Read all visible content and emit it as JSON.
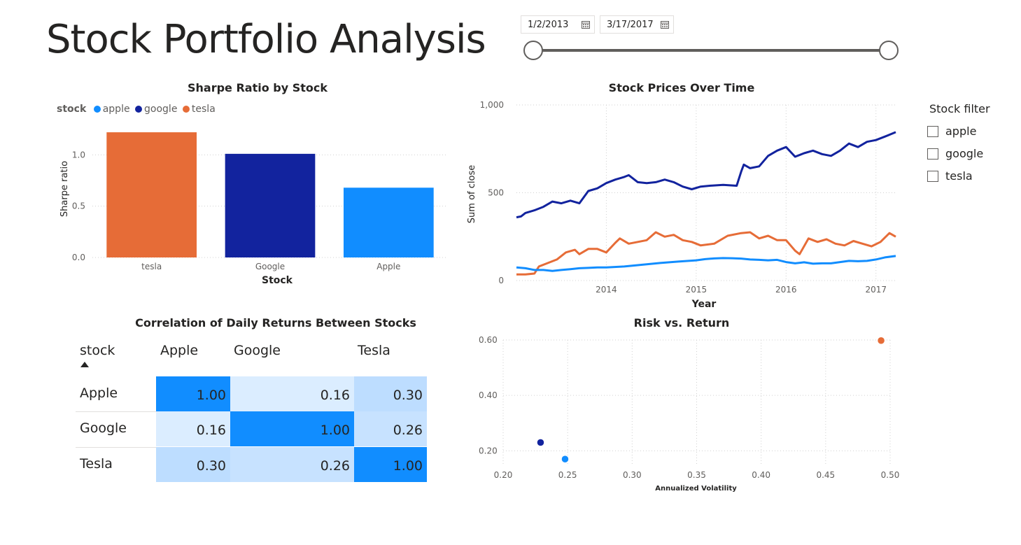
{
  "page": {
    "title": "Stock Portfolio Analysis"
  },
  "date_range": {
    "start": "1/2/2013",
    "end": "3/17/2017"
  },
  "stock_filter": {
    "title": "Stock filter",
    "options": [
      "apple",
      "google",
      "tesla"
    ]
  },
  "colors": {
    "apple": "#118DFF",
    "google": "#12239E",
    "tesla": "#E66C37"
  },
  "chart_data": [
    {
      "type": "bar",
      "title": "Sharpe Ratio by Stock",
      "legend_title": "stock",
      "legend": [
        "apple",
        "google",
        "tesla"
      ],
      "categories": [
        "tesla",
        "Google",
        "Apple"
      ],
      "values": [
        1.22,
        1.01,
        0.68
      ],
      "bar_colors": [
        "#E66C37",
        "#12239E",
        "#118DFF"
      ],
      "xlabel": "Stock",
      "ylabel": "Sharpe ratio",
      "ylim": [
        0,
        1.35
      ],
      "yticks": [
        0.0,
        0.5,
        1.0
      ],
      "ytick_labels": [
        "0.0",
        "0.5",
        "1.0"
      ],
      "grid": true
    },
    {
      "type": "line",
      "title": "Stock Prices Over Time",
      "xlabel": "Year",
      "ylabel": "Sum of close",
      "xlim": [
        2013.0,
        2017.22
      ],
      "xticks": [
        2014,
        2015,
        2016,
        2017
      ],
      "ylim": [
        0,
        1000
      ],
      "yticks": [
        0,
        500,
        1000
      ],
      "ytick_labels": [
        "0",
        "500",
        "1,000"
      ],
      "grid": true,
      "series": [
        {
          "color": "#12239E",
          "x": [
            2013.0,
            2013.05,
            2013.1,
            2013.2,
            2013.3,
            2013.4,
            2013.5,
            2013.6,
            2013.7,
            2013.8,
            2013.9,
            2014.0,
            2014.1,
            2014.2,
            2014.25,
            2014.35,
            2014.45,
            2014.55,
            2014.65,
            2014.75,
            2014.85,
            2014.95,
            2015.05,
            2015.15,
            2015.3,
            2015.45,
            2015.5,
            2015.53,
            2015.6,
            2015.7,
            2015.8,
            2015.9,
            2016.0,
            2016.1,
            2016.2,
            2016.3,
            2016.4,
            2016.5,
            2016.6,
            2016.7,
            2016.8,
            2016.9,
            2017.0,
            2017.1,
            2017.22
          ],
          "y": [
            360,
            365,
            385,
            400,
            420,
            450,
            440,
            455,
            440,
            510,
            525,
            555,
            575,
            590,
            600,
            560,
            555,
            560,
            575,
            560,
            535,
            520,
            535,
            540,
            545,
            540,
            620,
            660,
            640,
            650,
            710,
            740,
            760,
            705,
            725,
            740,
            720,
            710,
            740,
            780,
            760,
            790,
            800,
            820,
            845
          ]
        },
        {
          "color": "#E66C37",
          "x": [
            2013.0,
            2013.1,
            2013.2,
            2013.25,
            2013.35,
            2013.45,
            2013.55,
            2013.65,
            2013.7,
            2013.8,
            2013.9,
            2014.0,
            2014.1,
            2014.15,
            2014.25,
            2014.35,
            2014.45,
            2014.55,
            2014.65,
            2014.75,
            2014.85,
            2014.95,
            2015.05,
            2015.2,
            2015.35,
            2015.5,
            2015.6,
            2015.7,
            2015.8,
            2015.9,
            2016.0,
            2016.1,
            2016.15,
            2016.25,
            2016.35,
            2016.45,
            2016.55,
            2016.65,
            2016.75,
            2016.85,
            2016.95,
            2017.05,
            2017.15,
            2017.22
          ],
          "y": [
            35,
            35,
            40,
            80,
            100,
            120,
            160,
            175,
            150,
            180,
            180,
            160,
            215,
            240,
            210,
            220,
            230,
            275,
            250,
            260,
            230,
            220,
            200,
            210,
            255,
            270,
            275,
            240,
            255,
            230,
            230,
            170,
            150,
            240,
            220,
            235,
            210,
            200,
            225,
            210,
            195,
            220,
            270,
            250
          ]
        },
        {
          "color": "#118DFF",
          "x": [
            2013.0,
            2013.1,
            2013.2,
            2013.3,
            2013.4,
            2013.5,
            2013.6,
            2013.7,
            2013.8,
            2013.9,
            2014.0,
            2014.2,
            2014.4,
            2014.6,
            2014.8,
            2015.0,
            2015.1,
            2015.2,
            2015.3,
            2015.4,
            2015.5,
            2015.6,
            2015.7,
            2015.8,
            2015.9,
            2016.0,
            2016.1,
            2016.2,
            2016.3,
            2016.4,
            2016.5,
            2016.6,
            2016.7,
            2016.8,
            2016.9,
            2017.0,
            2017.1,
            2017.22
          ],
          "y": [
            75,
            70,
            60,
            60,
            55,
            60,
            65,
            70,
            72,
            75,
            75,
            80,
            90,
            100,
            108,
            115,
            122,
            126,
            128,
            127,
            125,
            120,
            118,
            115,
            118,
            105,
            98,
            104,
            96,
            98,
            98,
            105,
            112,
            110,
            112,
            120,
            132,
            140
          ]
        }
      ]
    },
    {
      "type": "table",
      "title": "Correlation of Daily Returns Between Stocks",
      "row_header": "stock",
      "columns": [
        "Apple",
        "Google",
        "Tesla"
      ],
      "rows": [
        {
          "label": "Apple",
          "values": [
            "1.00",
            "0.16",
            "0.30"
          ]
        },
        {
          "label": "Google",
          "values": [
            "0.16",
            "1.00",
            "0.26"
          ]
        },
        {
          "label": "Tesla",
          "values": [
            "0.30",
            "0.26",
            "1.00"
          ]
        }
      ],
      "cell_colors": [
        [
          "#118DFF",
          "#DBEDFF",
          "#BDDDFF"
        ],
        [
          "#DBEDFF",
          "#118DFF",
          "#C7E2FF"
        ],
        [
          "#BDDDFF",
          "#C7E2FF",
          "#118DFF"
        ]
      ]
    },
    {
      "type": "scatter",
      "title": "Risk vs. Return",
      "xlabel": "Annualized Volatility",
      "ylabel": "",
      "xlim": [
        0.2,
        0.5
      ],
      "xticks": [
        0.2,
        0.25,
        0.3,
        0.35,
        0.4,
        0.45,
        0.5
      ],
      "xtick_labels": [
        "0.20",
        "0.25",
        "0.30",
        "0.35",
        "0.40",
        "0.45",
        "0.50"
      ],
      "ylim": [
        0.12,
        0.6
      ],
      "yticks": [
        0.2,
        0.4,
        0.6
      ],
      "ytick_labels": "0.20|0.40|0.60",
      "grid": true,
      "points": [
        {
          "x": 0.229,
          "y": 0.23,
          "color": "#12239E"
        },
        {
          "x": 0.248,
          "y": 0.17,
          "color": "#118DFF"
        },
        {
          "x": 0.493,
          "y": 0.598,
          "color": "#E66C37"
        }
      ]
    }
  ]
}
